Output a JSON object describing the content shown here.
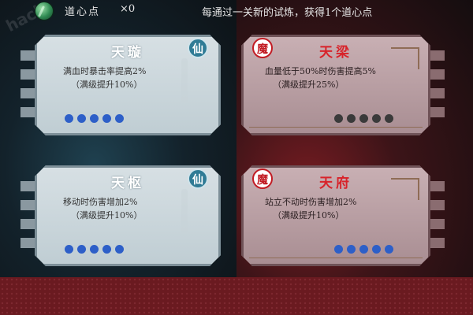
{
  "header": {
    "points_label": "道心点",
    "points_count": "×0",
    "hint": "每通过一关新的试炼，获得1个道心点",
    "watermark": "hack"
  },
  "cards": [
    {
      "id": "tianxuan",
      "title": "天璇",
      "badge": "仙",
      "effect": "满血时暴击率提高2%",
      "max_note": "（满级提升10%）",
      "level_filled": 5,
      "level_max": 5
    },
    {
      "id": "tianliang",
      "title": "天梁",
      "badge": "魔",
      "effect": "血量低于50%时伤害提高5%",
      "max_note": "（满级提升25%）",
      "level_filled": 0,
      "level_max": 5
    },
    {
      "id": "tianshu",
      "title": "天枢",
      "badge": "仙",
      "effect": "移动时伤害增加2%",
      "max_note": "（满级提升10%）",
      "level_filled": 5,
      "level_max": 5
    },
    {
      "id": "tianfu",
      "title": "天府",
      "badge": "魔",
      "effect": "站立不动时伤害增加2%",
      "max_note": "（满级提升10%）",
      "level_filled": 5,
      "level_max": 5
    }
  ],
  "colors": {
    "immortal_accent": "#2f7b95",
    "demon_accent": "#c21c24",
    "level_dot": "#2d5fc8",
    "level_dot_empty": "#3a3a3a"
  }
}
